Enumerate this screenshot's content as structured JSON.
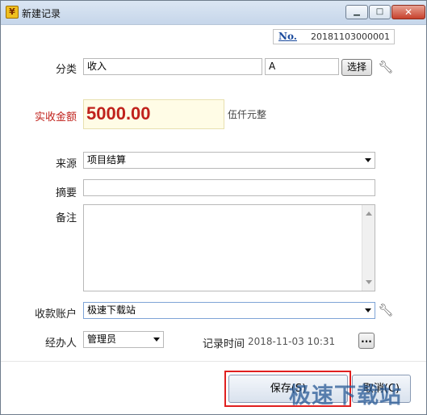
{
  "window": {
    "title": "新建记录",
    "app_icon": "app-logo-icon",
    "controls": [
      "minimize-icon",
      "maximize-icon",
      "close-icon"
    ]
  },
  "record": {
    "no_label": "No.",
    "number": "20181103000001"
  },
  "category": {
    "label": "分类",
    "value": "收入",
    "code": "A",
    "select_button": "选择"
  },
  "amount": {
    "label": "实收金额",
    "value": "5000.00",
    "in_words": "伍仟元整"
  },
  "source": {
    "label": "来源",
    "value": "项目结算"
  },
  "summary": {
    "label": "摘要",
    "value": ""
  },
  "note": {
    "label": "备注",
    "value": ""
  },
  "account": {
    "label": "收款账户",
    "value": "极速下载站"
  },
  "handler": {
    "label": "经办人",
    "value": "管理员"
  },
  "record_time": {
    "label": "记录时间",
    "value": "2018-11-03 10:31",
    "picker_button": "..."
  },
  "footer": {
    "save_label": "保存(S)",
    "cancel_label": "取消(C)",
    "watermark": "极速下载站"
  },
  "colors": {
    "amount_red": "#c0221c",
    "highlight_red": "#e02020",
    "amount_bg": "#fffce6"
  }
}
